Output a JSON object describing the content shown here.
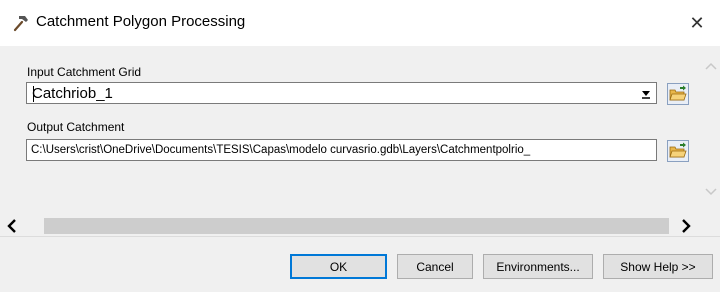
{
  "window": {
    "title": "Catchment Polygon Processing",
    "close_glyph": "✕",
    "icon": "hammer-icon"
  },
  "form": {
    "input_label": "Input Catchment Grid",
    "input_value": "Catchriob_1",
    "output_label": "Output Catchment",
    "output_value": "C:\\Users\\crist\\OneDrive\\Documents\\TESIS\\Capas\\modelo curvasrio.gdb\\Layers\\Catchmentpolrio_"
  },
  "buttons": {
    "ok": "OK",
    "cancel": "Cancel",
    "environments": "Environments...",
    "show_help": "Show Help >>"
  },
  "colors": {
    "accent": "#0078d7",
    "panel": "#f0f0f0",
    "folder": "#e8b64a"
  }
}
